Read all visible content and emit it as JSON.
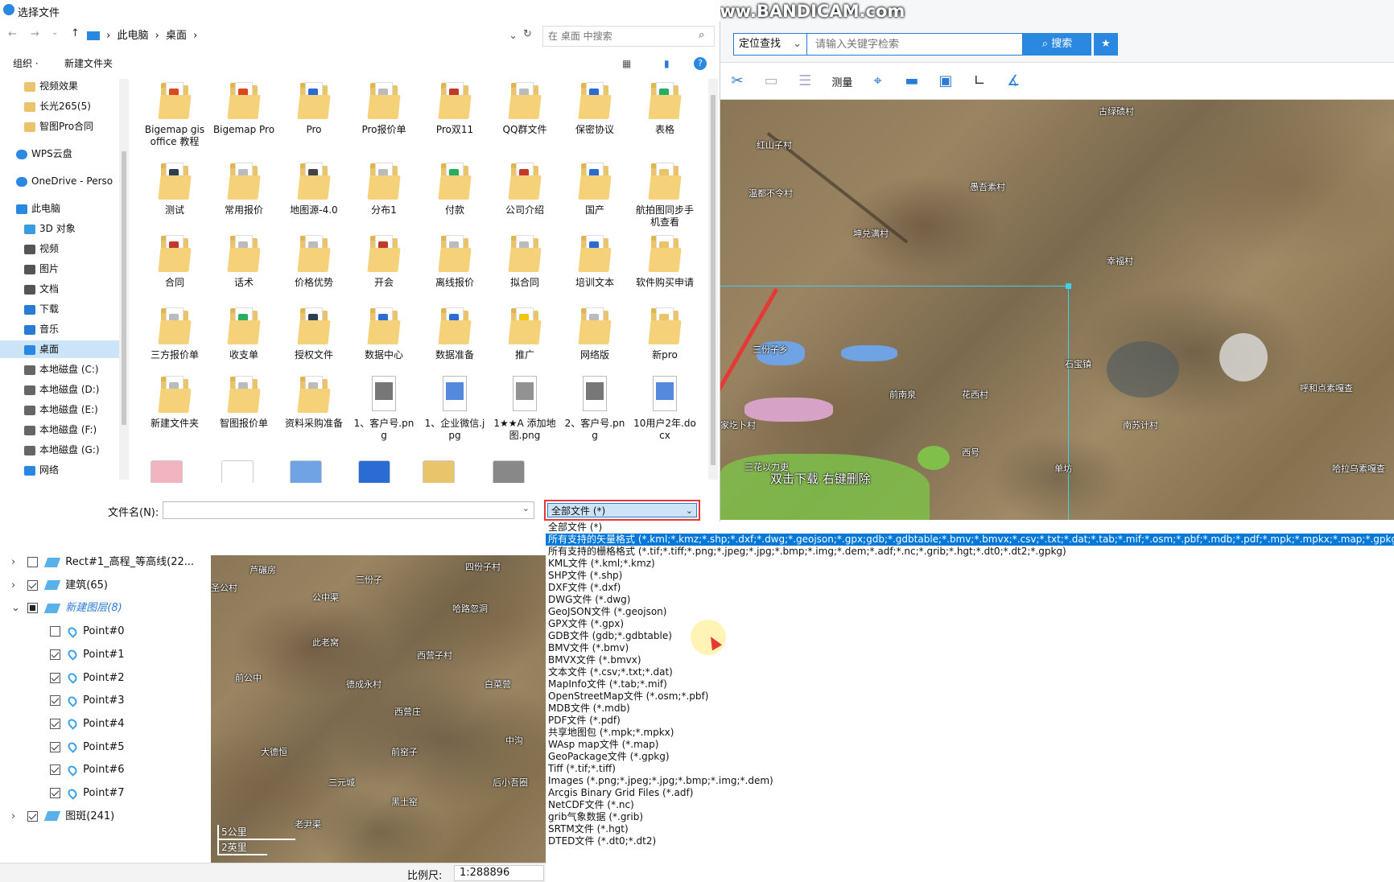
{
  "dialog": {
    "title": "选择文件",
    "breadcrumb": [
      "此电脑",
      "桌面"
    ],
    "search_placeholder": "在 桌面 中搜索",
    "organize": "组织 ·",
    "new_folder": "新建文件夹",
    "nav": [
      {
        "label": "视频效果",
        "icon": "folder-icon"
      },
      {
        "label": "长光265(5)",
        "icon": "folder-icon"
      },
      {
        "label": "智图Pro合同",
        "icon": "folder-icon"
      },
      {
        "label": "WPS云盘",
        "icon": "cloud-icon"
      },
      {
        "label": "OneDrive - Perso",
        "icon": "cloud-icon"
      },
      {
        "label": "此电脑",
        "icon": "computer-icon"
      },
      {
        "label": "3D 对象",
        "icon": "cube-icon"
      },
      {
        "label": "视频",
        "icon": "video-icon"
      },
      {
        "label": "图片",
        "icon": "picture-icon"
      },
      {
        "label": "文档",
        "icon": "document-icon"
      },
      {
        "label": "下载",
        "icon": "download-icon"
      },
      {
        "label": "音乐",
        "icon": "music-icon"
      },
      {
        "label": "桌面",
        "icon": "desktop-icon"
      },
      {
        "label": "本地磁盘 (C:)",
        "icon": "drive-icon"
      },
      {
        "label": "本地磁盘 (D:)",
        "icon": "drive-icon"
      },
      {
        "label": "本地磁盘 (E:)",
        "icon": "drive-icon"
      },
      {
        "label": "本地磁盘 (F:)",
        "icon": "drive-icon"
      },
      {
        "label": "本地磁盘 (G:)",
        "icon": "drive-icon"
      },
      {
        "label": "网络",
        "icon": "network-icon"
      }
    ],
    "files": [
      {
        "label": "Bigemap gis office 教程",
        "color": "#d9481f"
      },
      {
        "label": "Bigemap Pro",
        "color": "#d9481f"
      },
      {
        "label": "Pro",
        "color": "#2b6cd4"
      },
      {
        "label": "Pro报价单",
        "color": "#bbbbbb"
      },
      {
        "label": "Pro双11",
        "color": "#c0392b"
      },
      {
        "label": "QQ群文件",
        "color": "#bbbbbb"
      },
      {
        "label": "保密协议",
        "color": "#2b6cd4"
      },
      {
        "label": "表格",
        "color": "#27ae60"
      },
      {
        "label": "测试",
        "color": "#2c3e50"
      },
      {
        "label": "常用报价",
        "color": "#bbbbbb"
      },
      {
        "label": "地图源-4.0",
        "color": "#444444"
      },
      {
        "label": "分布1",
        "color": "#bbbbbb"
      },
      {
        "label": "付款",
        "color": "#27ae60"
      },
      {
        "label": "公司介绍",
        "color": "#c0392b"
      },
      {
        "label": "国产",
        "color": "#2b6cd4"
      },
      {
        "label": "航拍图同步手机查看",
        "color": "#e9c46a"
      },
      {
        "label": "合同",
        "color": "#c0392b"
      },
      {
        "label": "话术",
        "color": "#bbbbbb"
      },
      {
        "label": "价格优势",
        "color": "#bbbbbb"
      },
      {
        "label": "开会",
        "color": "#c0392b"
      },
      {
        "label": "离线报价",
        "color": "#bbbbbb"
      },
      {
        "label": "拟合同",
        "color": "#bbbbbb"
      },
      {
        "label": "培训文本",
        "color": "#2b6cd4"
      },
      {
        "label": "软件购买申请",
        "color": "#e9c46a"
      },
      {
        "label": "三方报价单",
        "color": "#bbbbbb"
      },
      {
        "label": "收支单",
        "color": "#27ae60"
      },
      {
        "label": "授权文件",
        "color": "#2c3e50"
      },
      {
        "label": "数据中心",
        "color": "#2b6cd4"
      },
      {
        "label": "数据准备",
        "color": "#2b6cd4"
      },
      {
        "label": "推广",
        "color": "#f1c40f"
      },
      {
        "label": "网络版",
        "color": "#bbbbbb"
      },
      {
        "label": "新pro",
        "color": "#e9c46a"
      },
      {
        "label": "新建文件夹",
        "color": "#bbbbbb"
      },
      {
        "label": "智图报价单",
        "color": "#bbbbbb"
      },
      {
        "label": "资料采购准备",
        "color": "#bbbbbb"
      },
      {
        "label": "1、客户号.png",
        "color": "#555555"
      },
      {
        "label": "1、企业微信.jpg",
        "color": "#2b6cd4"
      },
      {
        "label": "1★★A 添加地图.png",
        "color": "#777777"
      },
      {
        "label": "2、客户号.png",
        "color": "#555555"
      },
      {
        "label": "10用户2年.docx",
        "color": "#2b6cd4"
      }
    ],
    "filename_label": "文件名(N):",
    "filename_value": "",
    "filter_selected": "全部文件 (*)",
    "filter_options": [
      "全部文件 (*)",
      "所有支持的矢量格式 (*.kml;*.kmz;*.shp;*.dxf;*.dwg;*.geojson;*.gpx;gdb;*.gdbtable;*.bmv;*.bmvx;*.csv;*.txt;*.dat;*.tab;*.mif;*.osm;*.pbf;*.mdb;*.pdf;*.mpk;*.mpkx;*.map;*.gpkg)",
      "所有支持的栅格格式 (*.tif;*.tiff;*.png;*.jpeg;*.jpg;*.bmp;*.img;*.dem;*.adf;*.nc;*.grib;*.hgt;*.dt0;*.dt2;*.gpkg)",
      "KML文件 (*.kml;*.kmz)",
      "SHP文件 (*.shp)",
      "DXF文件 (*.dxf)",
      "DWG文件 (*.dwg)",
      "GeoJSON文件 (*.geojson)",
      "GPX文件 (*.gpx)",
      "GDB文件 (gdb;*.gdbtable)",
      "BMV文件 (*.bmv)",
      "BMVX文件 (*.bmvx)",
      "文本文件 (*.csv;*.txt;*.dat)",
      "MapInfo文件 (*.tab;*.mif)",
      "OpenStreetMap文件 (*.osm;*.pbf)",
      "MDB文件 (*.mdb)",
      "PDF文件 (*.pdf)",
      "共享地图包 (*.mpk;*.mpkx)",
      "WAsp map文件 (*.map)",
      "GeoPackage文件 (*.gpkg)",
      "Tiff (*.tif;*.tiff)",
      "Images (*.png;*.jpeg;*.jpg;*.bmp;*.img;*.dem)",
      "Arcgis Binary Grid Files (*.adf)",
      "NetCDF文件 (*.nc)",
      "grib气象数据 (*.grib)",
      "SRTM文件 (*.hgt)",
      "DTED文件 (*.dt0;*.dt2)"
    ],
    "highlighted_option": 1
  },
  "app": {
    "watermark": "www.BANDICAM.com",
    "locate_label": "定位查找",
    "search_placeholder": "请输入关键字检索",
    "search_button": "搜索",
    "measure_label": "测量",
    "map_hint": "双击下载 右键删除",
    "map_labels": [
      "古绿碛村",
      "红山子村",
      "温都不令村",
      "愚吾素村",
      "坤兑满村",
      "幸福村",
      "三份子乡",
      "石宝镇",
      "呼和点素嘎查",
      "前南泉",
      "花西村",
      "家圪卜村",
      "南苏计村",
      "西号",
      "单坊",
      "三花以力更",
      "哈拉乌素嘎查"
    ],
    "layers": [
      {
        "label": "Rect#1_高程_等高线(22...",
        "checked": false,
        "expander": "›"
      },
      {
        "label": "建筑(65)",
        "checked": true,
        "expander": "›"
      },
      {
        "label": "新建图层(8)",
        "checked": "partial",
        "expander": "⌄"
      },
      {
        "label": "Point#0",
        "checked": false
      },
      {
        "label": "Point#1",
        "checked": true
      },
      {
        "label": "Point#2",
        "checked": true
      },
      {
        "label": "Point#3",
        "checked": true
      },
      {
        "label": "Point#4",
        "checked": true
      },
      {
        "label": "Point#5",
        "checked": true
      },
      {
        "label": "Point#6",
        "checked": true
      },
      {
        "label": "Point#7",
        "checked": true
      },
      {
        "label": "图斑(241)",
        "checked": true,
        "expander": "›"
      }
    ],
    "mini_map_labels": [
      "芦碾房",
      "四份子村",
      "三份子",
      "圣公村",
      "公中渠",
      "哈路忽洞",
      "此老窝",
      "西营子村",
      "前公中",
      "德成永村",
      "白菜营",
      "西营庄",
      "中沟",
      "大德恒",
      "前窑子",
      "三元城",
      "后小吾圈",
      "黑土窑",
      "老尹渠"
    ],
    "scale_bar": [
      "5公里",
      "2英里"
    ],
    "scale_label": "比例尺:",
    "scale_value": "1:288896"
  }
}
